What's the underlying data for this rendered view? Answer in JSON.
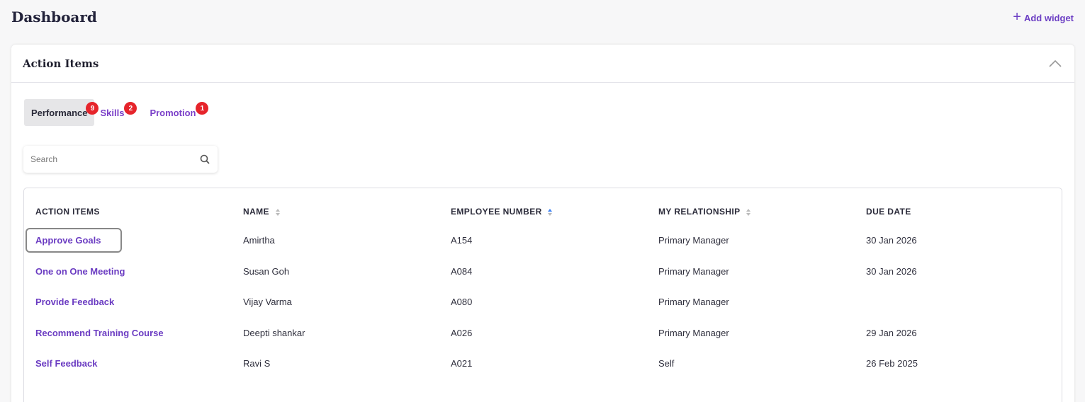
{
  "header": {
    "title": "Dashboard",
    "add_widget_label": "Add widget"
  },
  "card": {
    "title": "Action Items"
  },
  "tabs": [
    {
      "label": "Performance",
      "count": "9",
      "active": true
    },
    {
      "label": "Skills",
      "count": "2",
      "active": false
    },
    {
      "label": "Promotion",
      "count": "1",
      "active": false
    }
  ],
  "search": {
    "placeholder": "Search",
    "value": ""
  },
  "table": {
    "columns": [
      "ACTION ITEMS",
      "NAME",
      "EMPLOYEE NUMBER",
      "MY RELATIONSHIP",
      "DUE DATE"
    ],
    "rows": [
      {
        "action": "Approve Goals",
        "name": "Amirtha",
        "emp": "A154",
        "rel": "Primary Manager",
        "due": "30 Jan 2026"
      },
      {
        "action": "One on One Meeting",
        "name": "Susan Goh",
        "emp": "A084",
        "rel": "Primary Manager",
        "due": "30 Jan 2026"
      },
      {
        "action": "Provide Feedback",
        "name": "Vijay Varma",
        "emp": "A080",
        "rel": "Primary Manager",
        "due": ""
      },
      {
        "action": "Recommend Training Course",
        "name": "Deepti shankar",
        "emp": "A026",
        "rel": "Primary Manager",
        "due": "29 Jan 2026"
      },
      {
        "action": "Self Feedback",
        "name": "Ravi S",
        "emp": "A021",
        "rel": "Self",
        "due": "26 Feb 2025"
      }
    ]
  },
  "colors": {
    "accent": "#6b3cc2",
    "badge": "#e6242b",
    "sort_active": "#3b82f6"
  },
  "icons": {
    "add": "plus-icon",
    "collapse": "chevron-up-icon",
    "search": "search-icon",
    "sort": "sort-icon"
  }
}
